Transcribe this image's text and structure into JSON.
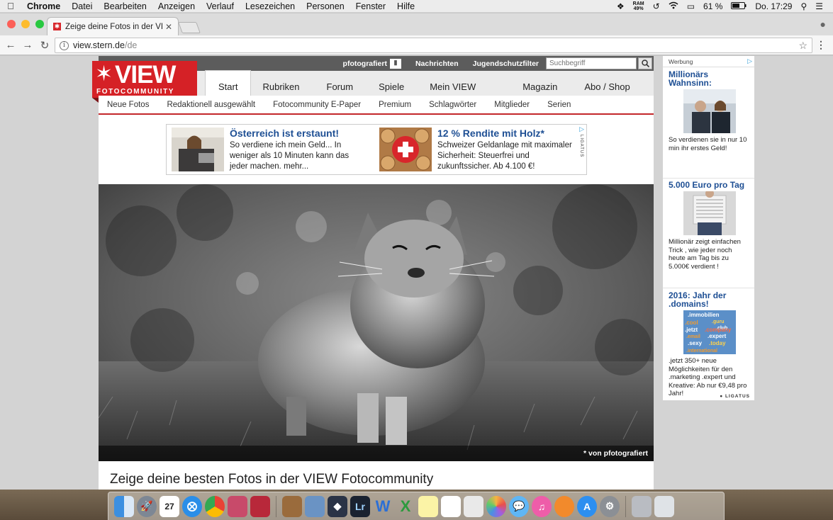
{
  "menubar": {
    "app": "Chrome",
    "items": [
      "Datei",
      "Bearbeiten",
      "Anzeigen",
      "Verlauf",
      "Lesezeichen",
      "Personen",
      "Fenster",
      "Hilfe"
    ],
    "ram_label": "RAM",
    "ram_value": "49%",
    "battery": "61 %",
    "clock": "Do. 17:29"
  },
  "browser": {
    "tab_title": "Zeige deine Fotos in der VIEW",
    "url_host": "view.stern.de",
    "url_path": "/de"
  },
  "site": {
    "topstrip": {
      "photographed": "pfotografiert",
      "news": "Nachrichten",
      "youth_filter": "Jugendschutzfilter",
      "search_placeholder": "Suchbegriff"
    },
    "logo": {
      "title": "VIEW",
      "subtitle": "FOTOCOMMUNITY"
    },
    "mainnav": [
      "Start",
      "Rubriken",
      "Forum",
      "Spiele",
      "Mein VIEW",
      "Magazin",
      "Abo / Shop"
    ],
    "subnav": [
      "Neue Fotos",
      "Redaktionell ausgewählt",
      "Fotocommunity E-Paper",
      "Premium",
      "Schlagwörter",
      "Mitglieder",
      "Serien"
    ],
    "ads": [
      {
        "headline": "Österreich ist erstaunt!",
        "text": "So verdiene ich mein Geld... In weniger als 10 Minuten kann das jeder machen. mehr..."
      },
      {
        "headline": "12 % Rendite mit Holz*",
        "text": "Schweizer Geldanlage mit maximaler Sicherheit: Steuerfrei und zukunftssicher. Ab 4.100 €!"
      }
    ],
    "ad_brand": "LIGATUS",
    "photo_credit": "* von pfotografiert",
    "headline": "Zeige deine besten Fotos in der VIEW Fotocommunity"
  },
  "sidebar_ad": {
    "label": "Werbung",
    "items": [
      {
        "title": "Millionärs Wahnsinn:",
        "text": "So verdienen sie in nur 10 min ihr erstes Geld!"
      },
      {
        "title": "5.000 Euro pro Tag",
        "text": "Millionär zeigt einfachen Trick , wie jeder noch heute am Tag bis zu 5.000€ verdient !"
      },
      {
        "title": "2016: Jahr der .domains!",
        "text": ".jetzt 350+ neue Möglichkeiten für den .marketing .expert und Kreative: Ab nur €9,48 pro Jahr!"
      }
    ],
    "domain_words": [
      ".immobilien",
      ".guru",
      ".cool",
      ".club",
      ".jetzt",
      ".company",
      ".email",
      ".expert",
      ".sexy",
      ".today",
      ".international"
    ],
    "brand": "LIGATUS"
  },
  "dock": {
    "icons": [
      "finder-icon",
      "launchpad-icon",
      "calendar-icon",
      "safari-icon",
      "chrome-icon",
      "photo-app-icon",
      "photo-app-2-icon",
      "notes-book-icon",
      "preview-icon",
      "affinity-icon",
      "lightroom-icon",
      "word-icon",
      "excel-icon",
      "stickies-icon",
      "reminders-icon",
      "keynote-icon",
      "photos-icon",
      "messages-icon",
      "itunes-icon",
      "ibooks-icon",
      "appstore-icon",
      "system-prefs-icon",
      "document-icon",
      "trash-icon"
    ],
    "calendar_day": "27",
    "lightroom_label": "Lr",
    "word_label": "W",
    "excel_label": "X"
  },
  "colors": {
    "brand_red": "#d52126",
    "ad_blue": "#1e4f94"
  }
}
